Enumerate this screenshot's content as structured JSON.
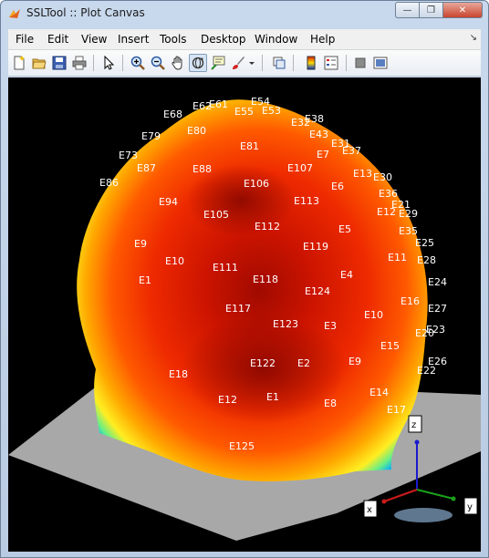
{
  "window": {
    "title": "SSLTool :: Plot Canvas",
    "min_glyph": "—",
    "max_glyph": "❐",
    "close_glyph": "✕"
  },
  "menu": {
    "items": [
      "File",
      "Edit",
      "View",
      "Insert",
      "Tools",
      "Desktop",
      "Window",
      "Help"
    ],
    "overflow_glyph": "↘"
  },
  "toolbar": {
    "tools": [
      {
        "icon": "new-figure-icon"
      },
      {
        "icon": "open-file-icon"
      },
      {
        "icon": "save-icon"
      },
      {
        "icon": "print-icon"
      },
      {
        "icon": "edit-plot-arrow-icon"
      },
      {
        "icon": "zoom-in-icon"
      },
      {
        "icon": "zoom-out-icon"
      },
      {
        "icon": "pan-hand-icon"
      },
      {
        "icon": "rotate-3d-icon",
        "active": true
      },
      {
        "icon": "data-cursor-icon"
      },
      {
        "icon": "brush-icon"
      },
      {
        "icon": "link-plot-icon"
      },
      {
        "icon": "colorbar-icon"
      },
      {
        "icon": "legend-icon"
      },
      {
        "icon": "hide-plot-tools-icon"
      },
      {
        "icon": "show-plot-tools-icon"
      }
    ]
  },
  "axes": {
    "x": "x",
    "y": "y",
    "z": "z"
  },
  "electrodes": [
    "E54",
    "E61",
    "E62",
    "E53",
    "E68",
    "E55",
    "E38",
    "E32",
    "E79",
    "E80",
    "E43",
    "E31",
    "E81",
    "E7",
    "E37",
    "E73",
    "E87",
    "E88",
    "E107",
    "E13",
    "E30",
    "E86",
    "E106",
    "E6",
    "E36",
    "E94",
    "E113",
    "E12",
    "E29",
    "E21",
    "E105",
    "E112",
    "E35",
    "E5",
    "E25",
    "E9",
    "E119",
    "E11",
    "E28",
    "E10",
    "E111",
    "E4",
    "E24",
    "E118",
    "E1",
    "E124",
    "E16",
    "E27",
    "E117",
    "E10",
    "E3",
    "E123",
    "E20",
    "E23",
    "E15",
    "E9",
    "E122",
    "E2",
    "E26",
    "E22",
    "E18",
    "E14",
    "E12",
    "E1",
    "E8",
    "E17",
    "E125"
  ],
  "colors": {
    "canvas_bg": "#000000",
    "floor": "#a8a8a8",
    "map_high": "#d41a00",
    "map_mid": "#ffdd00",
    "map_low": "#0033cc"
  }
}
